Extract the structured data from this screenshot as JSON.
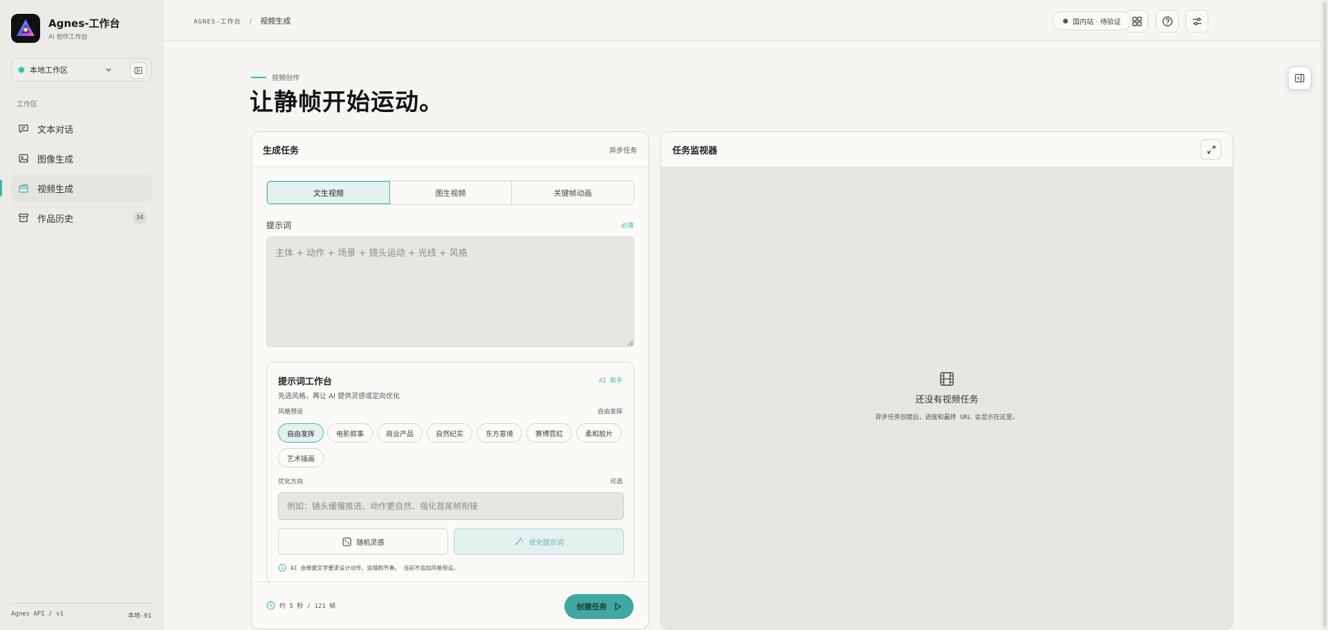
{
  "app": {
    "title": "Agnes-工作台",
    "subtitle": "AI 创作工作台"
  },
  "sidebar": {
    "workspace_label": "本地工作区",
    "section_label": "工作区",
    "items": [
      {
        "label": "文本对话",
        "icon": "chat-icon",
        "active": false
      },
      {
        "label": "图像生成",
        "icon": "image-icon",
        "active": false
      },
      {
        "label": "视频生成",
        "icon": "video-icon",
        "active": true
      },
      {
        "label": "作品历史",
        "icon": "archive-icon",
        "active": false,
        "badge": "34"
      }
    ],
    "footer_left": "Agnes API / v1",
    "footer_right": "本地-01"
  },
  "topbar": {
    "breadcrumb_root": "AGNES-工作台",
    "breadcrumb_sep": "/",
    "breadcrumb_current": "视频生成",
    "status": "国内站 · 待验证"
  },
  "hero": {
    "eyebrow": "视频创作",
    "title": "让静帧开始运动。"
  },
  "left_panel": {
    "title": "生成任务",
    "meta": "异步任务",
    "tabs": [
      {
        "label": "文生视频",
        "active": true
      },
      {
        "label": "图生视频",
        "active": false
      },
      {
        "label": "关键帧动画",
        "active": false
      }
    ],
    "prompt_label": "提示词",
    "prompt_required": "必填",
    "prompt_placeholder": "主体 + 动作 + 场景 + 镜头运动 + 光线 + 风格",
    "workbench": {
      "title": "提示词工作台",
      "ai_tag": "AI 助手",
      "desc": "先选风格，再让 AI 提供灵感或定向优化",
      "style_label": "风格预设",
      "style_current": "自由发挥",
      "chips": [
        {
          "label": "自由发挥",
          "active": true
        },
        {
          "label": "电影叙事",
          "active": false
        },
        {
          "label": "商业产品",
          "active": false
        },
        {
          "label": "自然纪实",
          "active": false
        },
        {
          "label": "东方意境",
          "active": false
        },
        {
          "label": "赛博霓虹",
          "active": false
        },
        {
          "label": "柔和胶片",
          "active": false
        },
        {
          "label": "艺术插画",
          "active": false
        }
      ],
      "direction_label": "优化方向",
      "direction_optional": "可选",
      "direction_placeholder": "例如：镜头缓慢推进、动作更自然、强化首尾帧衔接",
      "random_label": "随机灵感",
      "optimize_label": "优化提示词",
      "note": "AI 会根据文字要求设计动作、运镜和节奏。 当前不追加风格预设。"
    },
    "estimate": "约 5 秒 / 121 帧",
    "create_label": "创建任务"
  },
  "right_panel": {
    "title": "任务监视器",
    "empty_title": "还没有视频任务",
    "empty_desc": "异步任务创建后，进度和最终 URL 会显示在这里。"
  },
  "colors": {
    "accent": "#3db6b0",
    "button": "#3fa8a2",
    "bg": "#f6f5f1"
  }
}
